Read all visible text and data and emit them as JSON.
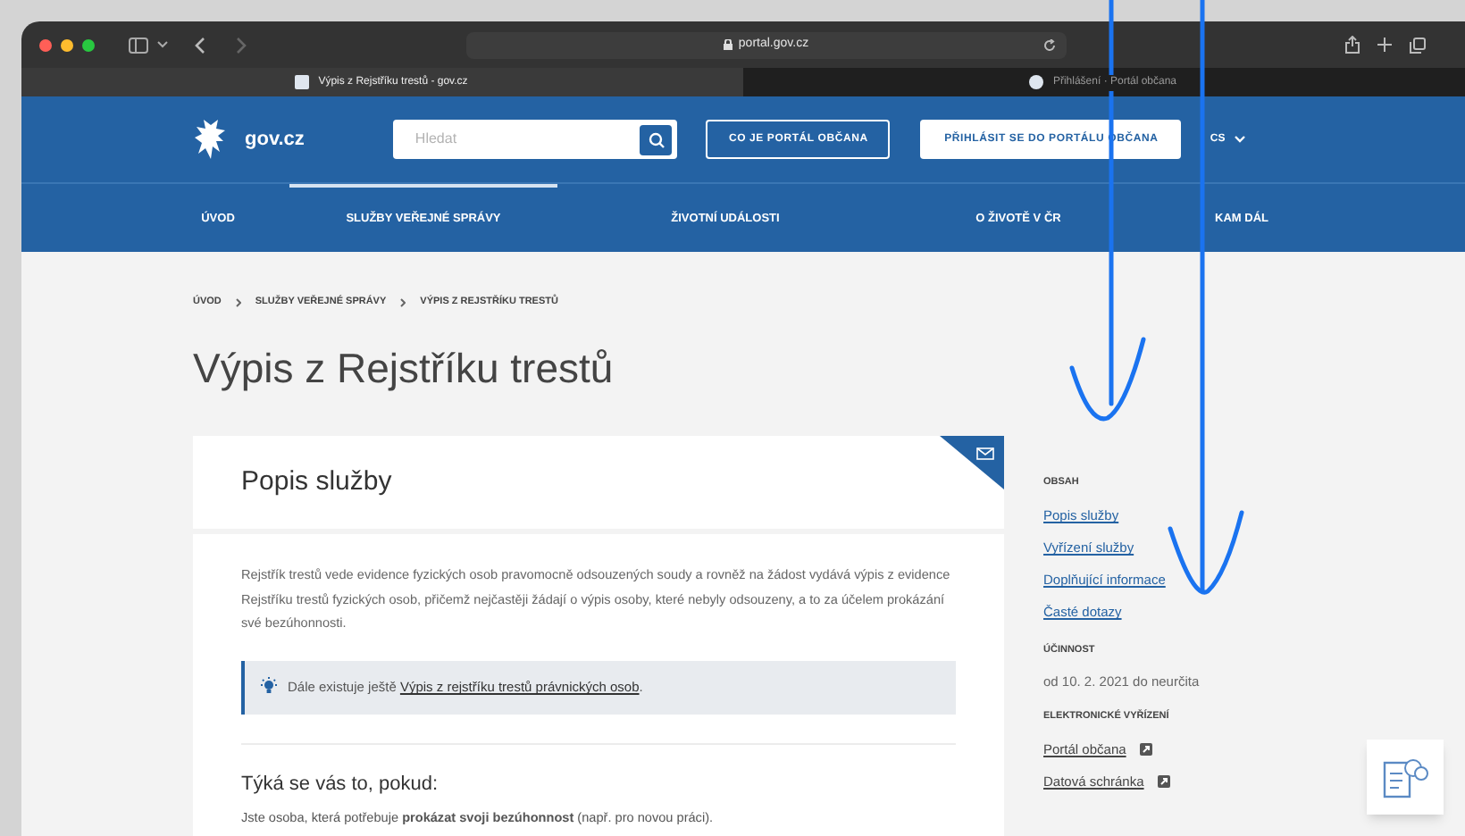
{
  "browser": {
    "url": "portal.gov.cz",
    "tabs": [
      {
        "title": "Výpis z Rejstříku trestů - gov.cz",
        "selected": true
      },
      {
        "title": "Přihlášení · Portál občana",
        "selected": false
      }
    ]
  },
  "header": {
    "logo_text": "gov.cz",
    "search_placeholder": "Hledat",
    "buttons": [
      {
        "label": "CO JE PORTÁL OBČANA",
        "kind": "outline"
      },
      {
        "label": "PŘIHLÁSIT SE DO PORTÁLU OBČANA",
        "kind": "solid"
      }
    ],
    "language": "CS"
  },
  "nav": [
    {
      "label": "ÚVOD",
      "selected": false
    },
    {
      "label": "SLUŽBY VEŘEJNÉ SPRÁVY",
      "selected": true
    },
    {
      "label": "ŽIVOTNÍ UDÁLOSTI",
      "selected": false
    },
    {
      "label": "O ŽIVOTĚ V ČR",
      "selected": false
    },
    {
      "label": "KAM DÁL",
      "selected": false
    }
  ],
  "breadcrumb": [
    "ÚVOD",
    "SLUŽBY VEŘEJNÉ SPRÁVY",
    "VÝPIS Z REJSTŘÍKU TRESTŮ"
  ],
  "page_title": "Výpis z Rejstříku trestů",
  "card": {
    "title": "Popis služby",
    "paragraph": "Rejstřík trestů vede evidence fyzických osob pravomocně odsouzených soudy a rovněž na žádost vydává výpis z evidence Rejstříku trestů fyzických osob, přičemž nejčastěji žádají o výpis osoby, které nebyly odsouzeny, a to za účelem prokázání své bezúhonnosti.",
    "info": {
      "text": "Dále existuje ještě ",
      "link": "Výpis z rejstříku trestů právnických osob",
      "suffix": "."
    },
    "subheading": "Týká se vás to, pokud:",
    "condition": "Jste osoba, která potřebuje **prokázat svoji bezúhonnost** (např. pro novou práci)."
  },
  "sidebar": [
    {
      "heading": "OBSAH",
      "items": [
        {
          "label": "Popis služby",
          "kind": "link"
        },
        {
          "label": "Vyřízení služby",
          "kind": "link"
        },
        {
          "label": "Doplňující informace",
          "kind": "link"
        },
        {
          "label": "Časté dotazy",
          "kind": "link"
        }
      ]
    },
    {
      "heading": "ÚČINNOST",
      "items": [
        {
          "label": "od 10. 2. 2021 do neurčita",
          "kind": "text"
        }
      ]
    },
    {
      "heading": "ELEKTRONICKÉ VYŘÍZENÍ",
      "items": [
        {
          "label": "Portál občana",
          "kind": "external"
        },
        {
          "label": "Datová schránka",
          "kind": "external"
        }
      ]
    }
  ]
}
